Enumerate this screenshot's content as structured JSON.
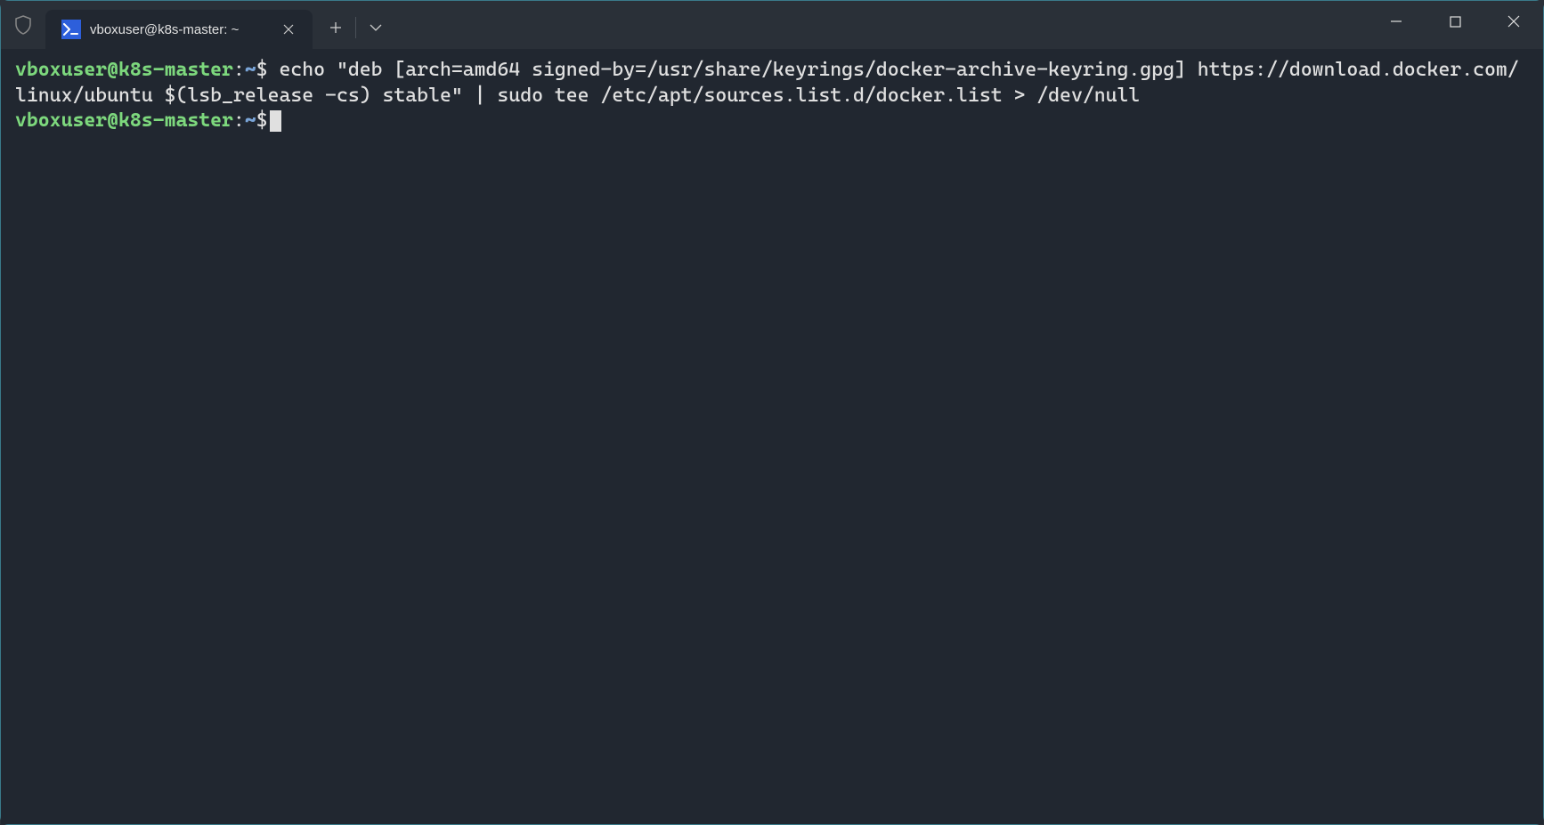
{
  "tab": {
    "title": "vboxuser@k8s-master: ~",
    "icon_glyph": ">_"
  },
  "terminal": {
    "lines": [
      {
        "prompt_user": "vboxuser@k8s-master",
        "prompt_colon": ":",
        "prompt_path": "~",
        "prompt_dollar": "$",
        "command": " echo \"deb [arch=amd64 signed-by=/usr/share/keyrings/docker-archive-keyring.gpg] https://download.docker.com/linux/ubuntu $(lsb_release -cs) stable\" | sudo tee /etc/apt/sources.list.d/docker.list > /dev/null"
      },
      {
        "prompt_user": "vboxuser@k8s-master",
        "prompt_colon": ":",
        "prompt_path": "~",
        "prompt_dollar": "$",
        "command": ""
      }
    ]
  }
}
